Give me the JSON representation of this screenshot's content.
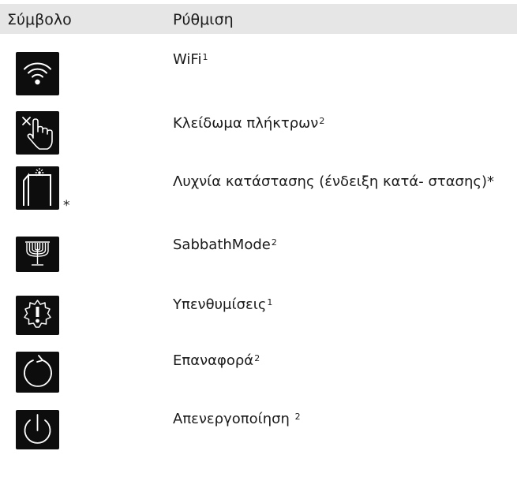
{
  "table": {
    "header": {
      "symbol": "Σύμβολο",
      "setting": "Ρύθμιση"
    },
    "rows": [
      {
        "icon": "wifi-icon",
        "label": "WiFi",
        "note": "1"
      },
      {
        "icon": "key-lock-icon",
        "label": "Κλείδωμα πλήκτρων",
        "note": "2"
      },
      {
        "icon": "status-light-icon",
        "label": "Λυχνία κατάστασης (ένδειξη κατά- στασης)*",
        "note": "",
        "marker": "*"
      },
      {
        "icon": "menorah-icon",
        "label": "SabbathMode",
        "note": "2"
      },
      {
        "icon": "reminder-gear-icon",
        "label": "Υπενθυμίσεις",
        "note": "1"
      },
      {
        "icon": "reset-icon",
        "label": "Επαναφορά",
        "note": "2"
      },
      {
        "icon": "power-icon",
        "label": "Απενεργοποίηση ",
        "note": "2"
      }
    ]
  }
}
